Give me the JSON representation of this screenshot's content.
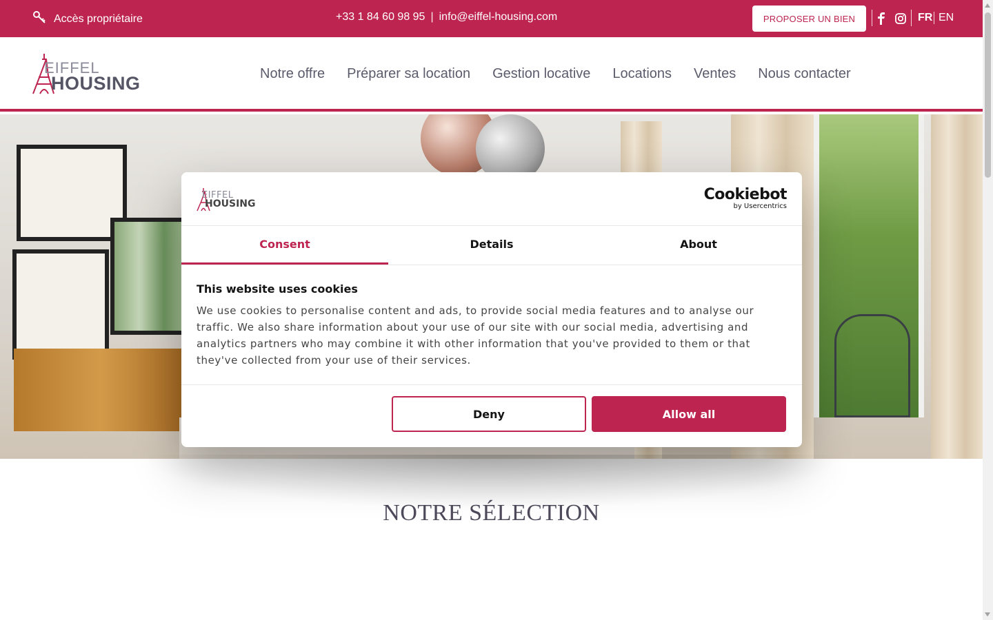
{
  "topbar": {
    "owner_access": "Accès propriétaire",
    "phone": "+33 1 84 60 98 95",
    "separator": "|",
    "email": "info@eiffel-housing.com",
    "propose_button": "PROPOSER UN BIEN",
    "lang_fr": "FR",
    "lang_en": "EN",
    "social": [
      "facebook-icon",
      "instagram-icon"
    ]
  },
  "logo": {
    "line1": "EIFFEL",
    "line2": "HOUSING"
  },
  "nav": {
    "items": [
      "Notre offre",
      "Préparer sa location",
      "Gestion locative",
      "Locations",
      "Ventes",
      "Nous contacter"
    ]
  },
  "section": {
    "title": "NOTRE SÉLECTION"
  },
  "cookie": {
    "logo_line1": "EIFFEL",
    "logo_line2": "HOUSING",
    "brand": "Cookiebot",
    "brand_sub": "by Usercentrics",
    "tabs": [
      "Consent",
      "Details",
      "About"
    ],
    "active_tab": "Consent",
    "heading": "This website uses cookies",
    "body": "We use cookies to personalise content and ads, to provide social media features and to analyse our traffic. We also share information about your use of our site with our social media, advertising and analytics partners who may combine it with other information that you've provided to them or that they've collected from your use of their services.",
    "deny": "Deny",
    "allow": "Allow all"
  },
  "colors": {
    "brand": "#bd2550",
    "text": "#5b5b6b"
  }
}
